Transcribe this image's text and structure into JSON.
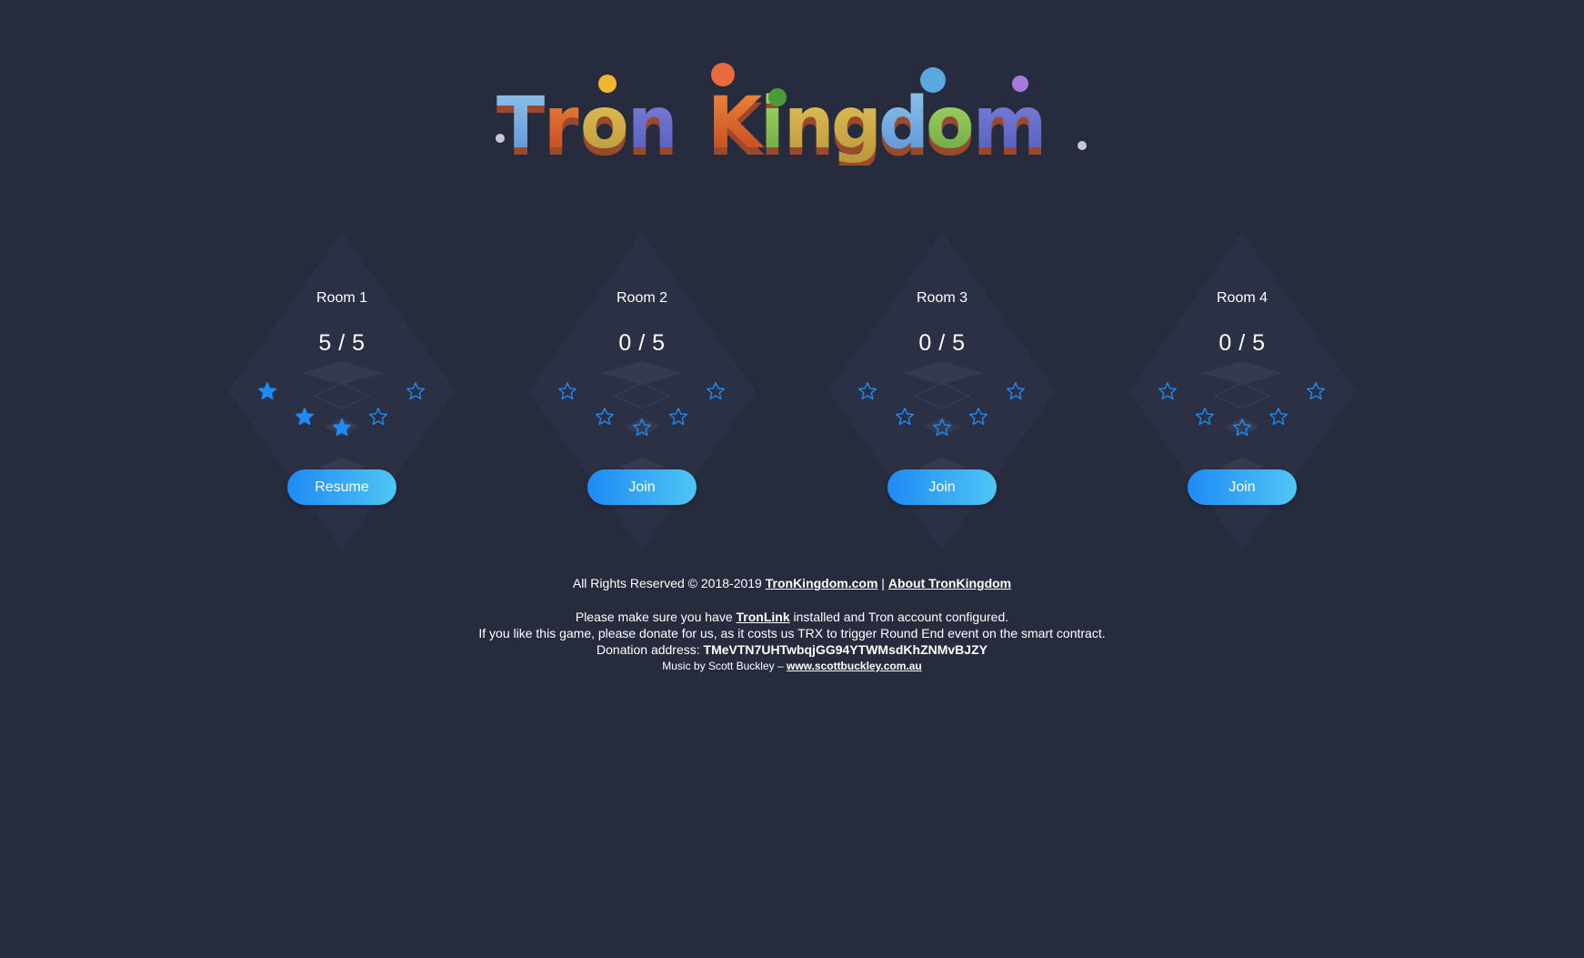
{
  "logo": {
    "text": "Tron Kingdom"
  },
  "rooms": [
    {
      "title": "Room 1",
      "count": "5 / 5",
      "filled": 3,
      "button": "Resume"
    },
    {
      "title": "Room 2",
      "count": "0 / 5",
      "filled": 0,
      "button": "Join"
    },
    {
      "title": "Room 3",
      "count": "0 / 5",
      "filled": 0,
      "button": "Join"
    },
    {
      "title": "Room 4",
      "count": "0 / 5",
      "filled": 0,
      "button": "Join"
    }
  ],
  "footer": {
    "rights": "All Rights Reserved © 2018-2019",
    "site_link": "TronKingdom.com",
    "separator": "|",
    "about_link": "About TronKingdom",
    "tronlink_prefix": "Please make sure you have",
    "tronlink_link": "TronLink",
    "tronlink_suffix": "installed and Tron account configured.",
    "donate_text": "If you like this game, please donate for us, as it costs us TRX to trigger Round End event on the smart contract.",
    "donation_label": "Donation address:",
    "donation_address": "TMeVTN7UHTwbqjGG94YTWMsdKhZNMvBJZY",
    "music_prefix": "Music by Scott Buckley –",
    "music_link": "www.scottbuckley.com.au"
  },
  "colors": {
    "background": "#262b3d",
    "star": "#1e8af5",
    "button_start": "#1e8af5",
    "button_end": "#4fc6f3"
  }
}
